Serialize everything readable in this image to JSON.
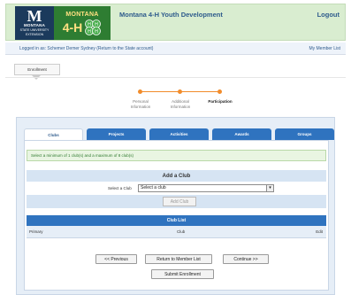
{
  "header": {
    "logo": {
      "msu_letter": "M",
      "msu_line1": "MONTANA",
      "msu_line2": "STATE UNIVERSITY",
      "msu_line3": "EXTENSION",
      "program_name": "MONTANA",
      "program_mark": "4-H"
    },
    "title": "Montana 4-H Youth Development",
    "logout_label": "Logout"
  },
  "login_bar": {
    "logged_in_text": "Logged in as: Schemer Demer Sydney (Return to the State account)",
    "my_member_list": "My Member List"
  },
  "breadcrumb": {
    "enrollment_label": "Enrollment"
  },
  "progress": {
    "steps": [
      {
        "line1": "Personal",
        "line2": "Information"
      },
      {
        "line1": "Additional",
        "line2": "Information"
      },
      {
        "line1": "Participation",
        "line2": ""
      }
    ],
    "current_step_index": 2,
    "accent_color": "#f28c2b"
  },
  "tabs": [
    "Clubs",
    "Projects",
    "Activities",
    "Awards",
    "Groups"
  ],
  "active_tab": "Clubs",
  "notice": "Select a minimum of 1 club(s) and a maximum of 8 club(s)",
  "add_club": {
    "heading": "Add a Club",
    "select_label": "Select a Club",
    "select_value": "Select a club",
    "add_button": "Add Club"
  },
  "club_list": {
    "heading": "Club List",
    "columns": {
      "primary": "Primary",
      "club": "Club",
      "edit": "Edit"
    }
  },
  "footer_buttons": {
    "previous": "<< Previous",
    "return": "Return to Member List",
    "continue": "Continue >>",
    "submit": "Submit Enrollment"
  },
  "colors": {
    "brand_green": "#2e7d32",
    "header_bg": "#d9edd0",
    "tab_blue": "#2f73bf",
    "link_blue": "#2e5b8c"
  }
}
